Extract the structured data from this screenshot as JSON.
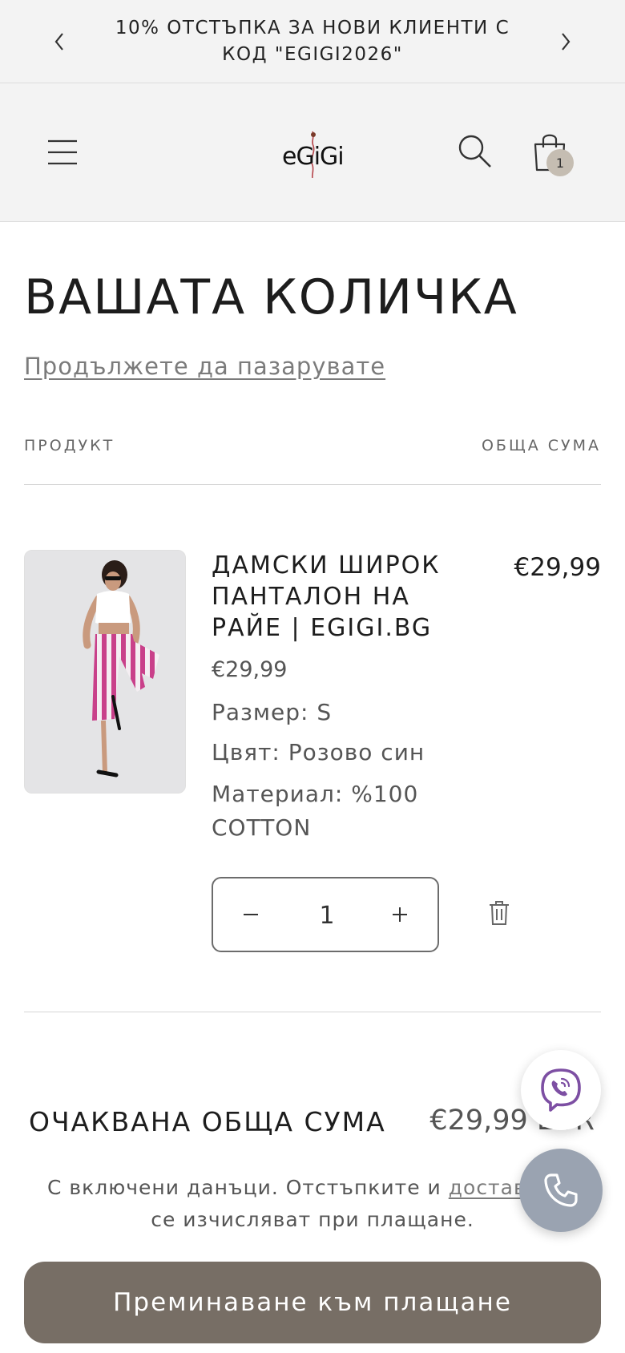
{
  "announcement": {
    "text": "10% ОТСТЪПКА ЗА НОВИ КЛИЕНТИ С КОД \"EGIGI2026\""
  },
  "header": {
    "logo_text": "eGiGi",
    "cart_count": "1"
  },
  "cart": {
    "title": "ВАШАТА КОЛИЧКА",
    "continue_label": "Продължете да пазарувате",
    "col_product": "ПРОДУКТ",
    "col_total": "ОБЩА СУМА",
    "item": {
      "name": "ДАМСКИ ШИРОК ПАНТАЛОН НА РАЙЕ | EGIGI.BG",
      "price": "€29,99",
      "line_total": "€29,99",
      "size": "Размер: S",
      "color": "Цвят: Розово син",
      "material": "Материал: %100 COTTON",
      "quantity": "1"
    },
    "estimated_label": "ОЧАКВАНА ОБЩА СУМА",
    "estimated_value": "€29,99 EUR",
    "tax_note_before": "С включени данъци. Отстъпките и ",
    "tax_note_link": "доставката",
    "tax_note_after": " се изчисляват при плащане.",
    "checkout_label": "Преминаване към плащане"
  },
  "colors": {
    "checkout_bg": "#776e65",
    "header_bg": "#f3f3f3",
    "phone_bg": "#9aa3b1",
    "viber": "#7d4fa3"
  },
  "icons": {
    "prev": "chevron-left-icon",
    "next": "chevron-right-icon",
    "menu": "hamburger-menu-icon",
    "search": "search-icon",
    "cart": "shopping-bag-icon",
    "minus": "minus-icon",
    "plus": "plus-icon",
    "remove": "trash-icon",
    "viber": "viber-icon",
    "phone": "phone-icon"
  }
}
